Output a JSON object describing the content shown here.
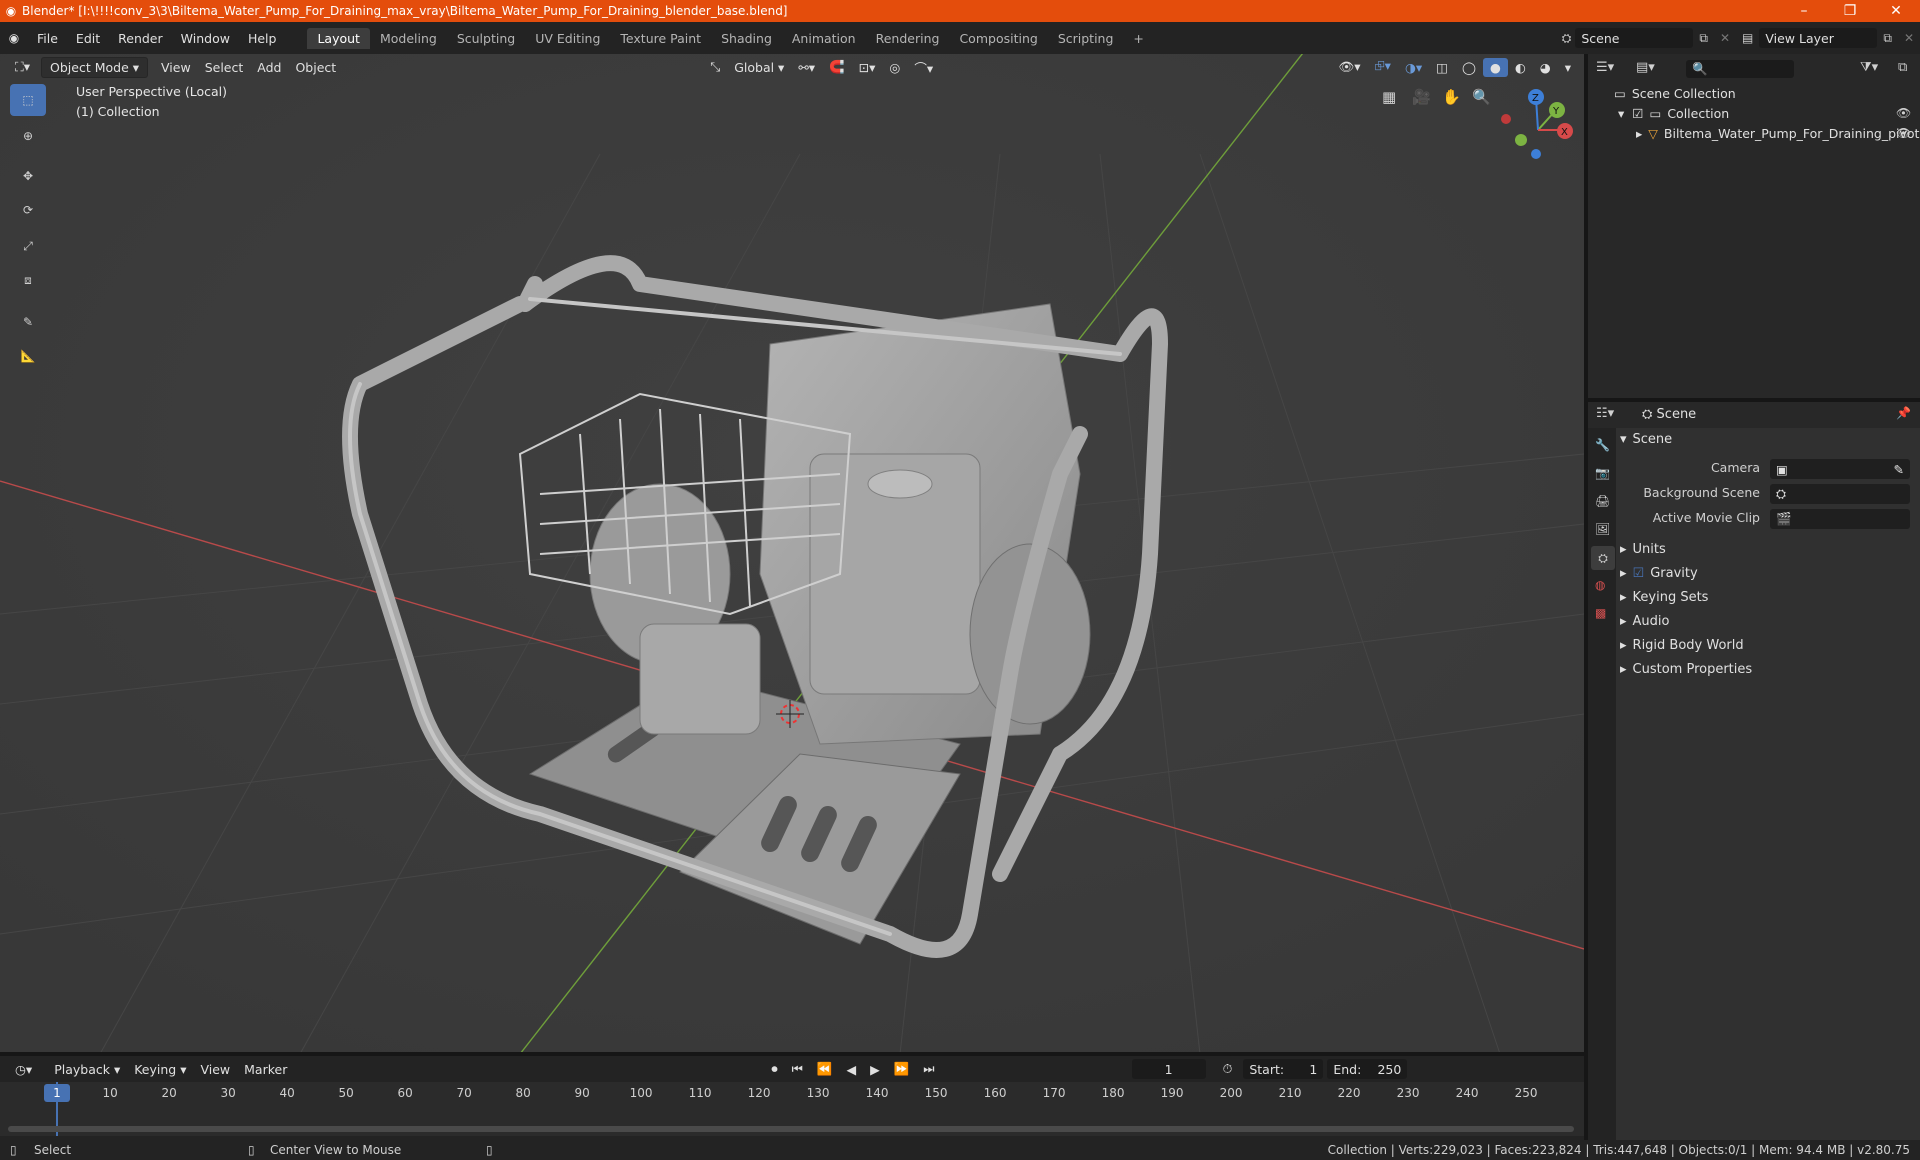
{
  "window": {
    "title": "Blender* [I:\\!!!!conv_3\\3\\Biltema_Water_Pump_For_Draining_max_vray\\Biltema_Water_Pump_For_Draining_blender_base.blend]"
  },
  "menu": [
    "File",
    "Edit",
    "Render",
    "Window",
    "Help"
  ],
  "workspaces": [
    "Layout",
    "Modeling",
    "Sculpting",
    "UV Editing",
    "Texture Paint",
    "Shading",
    "Animation",
    "Rendering",
    "Compositing",
    "Scripting"
  ],
  "scene_field": "Scene",
  "viewlayer_field": "View Layer",
  "viewport": {
    "mode": "Object Mode",
    "menus": [
      "View",
      "Select",
      "Add",
      "Object"
    ],
    "transform_orientation": "Global",
    "overlay_title": "User Perspective (Local)",
    "overlay_collection": "(1) Collection",
    "gizmo": {
      "x": "X",
      "y": "Y",
      "z": "Z"
    }
  },
  "outliner": {
    "root": "Scene Collection",
    "collection": "Collection",
    "object": "Biltema_Water_Pump_For_Draining_pivot"
  },
  "properties": {
    "header": "Scene",
    "panel": "Scene",
    "camera_label": "Camera",
    "background_label": "Background Scene",
    "movieclip_label": "Active Movie Clip",
    "sections": [
      "Units",
      "Gravity",
      "Keying Sets",
      "Audio",
      "Rigid Body World",
      "Custom Properties"
    ]
  },
  "timeline": {
    "menus": [
      "Playback",
      "Keying",
      "View",
      "Marker"
    ],
    "current_frame": "1",
    "start_label": "Start:",
    "start": "1",
    "end_label": "End:",
    "end": "250",
    "ticks": [
      "1",
      "10",
      "20",
      "30",
      "40",
      "50",
      "60",
      "70",
      "80",
      "90",
      "100",
      "110",
      "120",
      "130",
      "140",
      "150",
      "160",
      "170",
      "180",
      "190",
      "200",
      "210",
      "220",
      "230",
      "240",
      "250"
    ]
  },
  "status": {
    "left": "Select",
    "middle": "Center View to Mouse",
    "right": "Collection | Verts:229,023 | Faces:223,824 | Tris:447,648 | Objects:0/1 | Mem: 94.4 MB | v2.80.75"
  },
  "colors": {
    "accent": "#4772b3",
    "titlebar": "#e44d0c",
    "x_axis": "#d64a4a",
    "y_axis": "#7cb342",
    "z_axis": "#3d7fd8"
  }
}
